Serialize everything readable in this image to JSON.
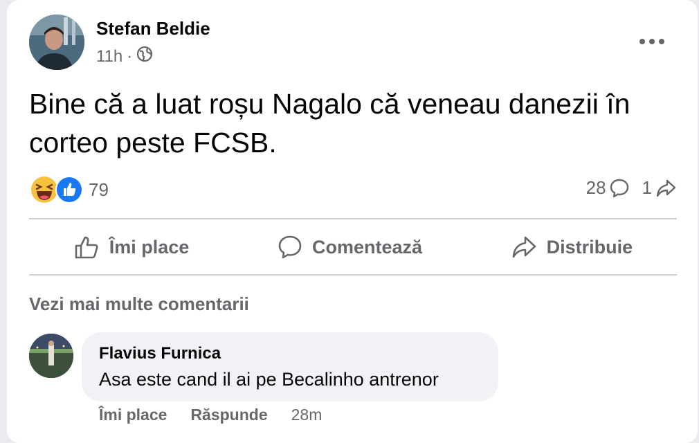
{
  "post": {
    "author": "Stefan Beldie",
    "time": "11h",
    "separator": "·",
    "privacy_icon": "globe-icon",
    "text": "Bine că a luat roșu Nagalo că veneau danezii în corteo peste FCSB.",
    "reactions": {
      "icons": [
        "haha-icon",
        "like-icon"
      ],
      "count": "79"
    },
    "comments_count": "28",
    "shares_count": "1"
  },
  "actions": {
    "like": "Îmi place",
    "comment": "Comentează",
    "share": "Distribuie"
  },
  "see_more_comments": "Vezi mai multe comentarii",
  "comment": {
    "author": "Flavius Furnica",
    "text": "Asa este cand il ai pe Becalinho antrenor",
    "like": "Îmi place",
    "reply": "Răspunde",
    "time": "28m"
  },
  "colors": {
    "text": "#050505",
    "secondary": "#65676b",
    "like_blue": "#1877f2",
    "haha_yellow": "#f7c23b",
    "bubble": "#f0f2f5",
    "divider": "#ced0d4"
  }
}
